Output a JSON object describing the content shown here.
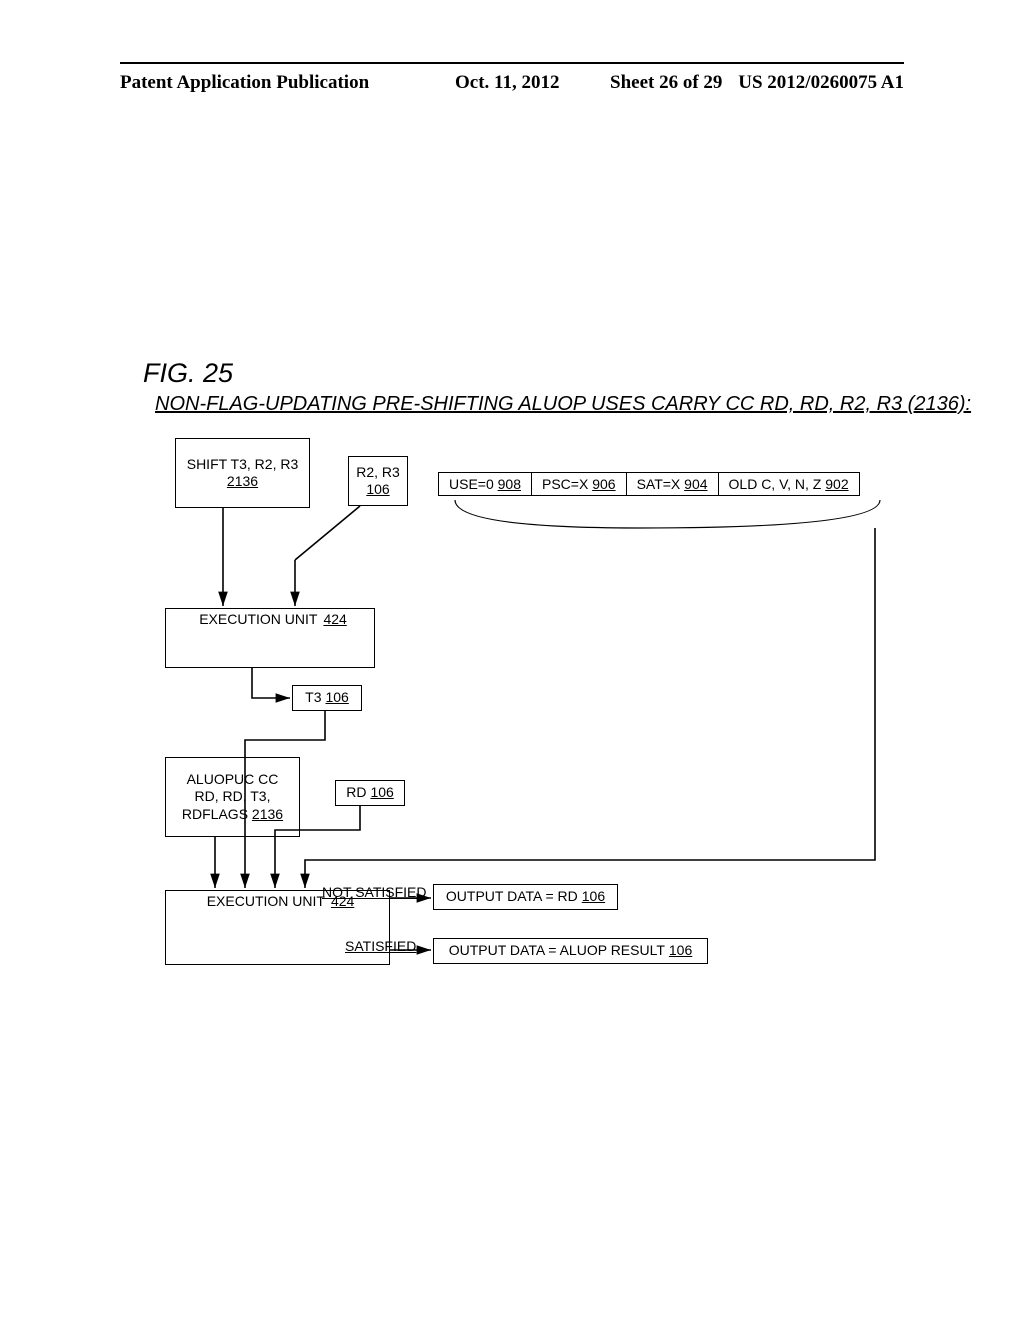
{
  "header": {
    "publication": "Patent Application Publication",
    "date": "Oct. 11, 2012",
    "sheet": "Sheet 26 of 29",
    "docnum": "US 2012/0260075 A1"
  },
  "figure_label": "FIG. 25",
  "title": "NON-FLAG-UPDATING PRE-SHIFTING ALUOP USES CARRY CC RD, RD, R2, R3 (2136):",
  "shift_box": {
    "line1": "SHIFT T3, R2, R3",
    "ref": "2136"
  },
  "r2r3_box": {
    "line1": "R2, R3",
    "ref": "106"
  },
  "flags": {
    "use": "USE=0",
    "use_ref": "908",
    "psc": "PSC=X",
    "psc_ref": "906",
    "sat": "SAT=X",
    "sat_ref": "904",
    "old": "OLD C, V, N, Z",
    "old_ref": "902"
  },
  "exec1": {
    "label": "EXECUTION UNIT",
    "ref": "424"
  },
  "t3_box": {
    "label": "T3",
    "ref": "106"
  },
  "aluop_box": {
    "line1": "ALUOPUC CC",
    "line2": "RD, RD, T3,",
    "line3": "RDFLAGS",
    "ref": "2136"
  },
  "rd_box": {
    "label": "RD",
    "ref": "106"
  },
  "exec2": {
    "label": "EXECUTION UNIT",
    "ref": "424"
  },
  "not_satisfied_label": "NOT SATISFIED",
  "satisfied_label": "SATISFIED",
  "out_not": {
    "label": "OUTPUT DATA = RD",
    "ref": "106"
  },
  "out_sat": {
    "label": "OUTPUT DATA = ALUOP RESULT",
    "ref": "106"
  }
}
